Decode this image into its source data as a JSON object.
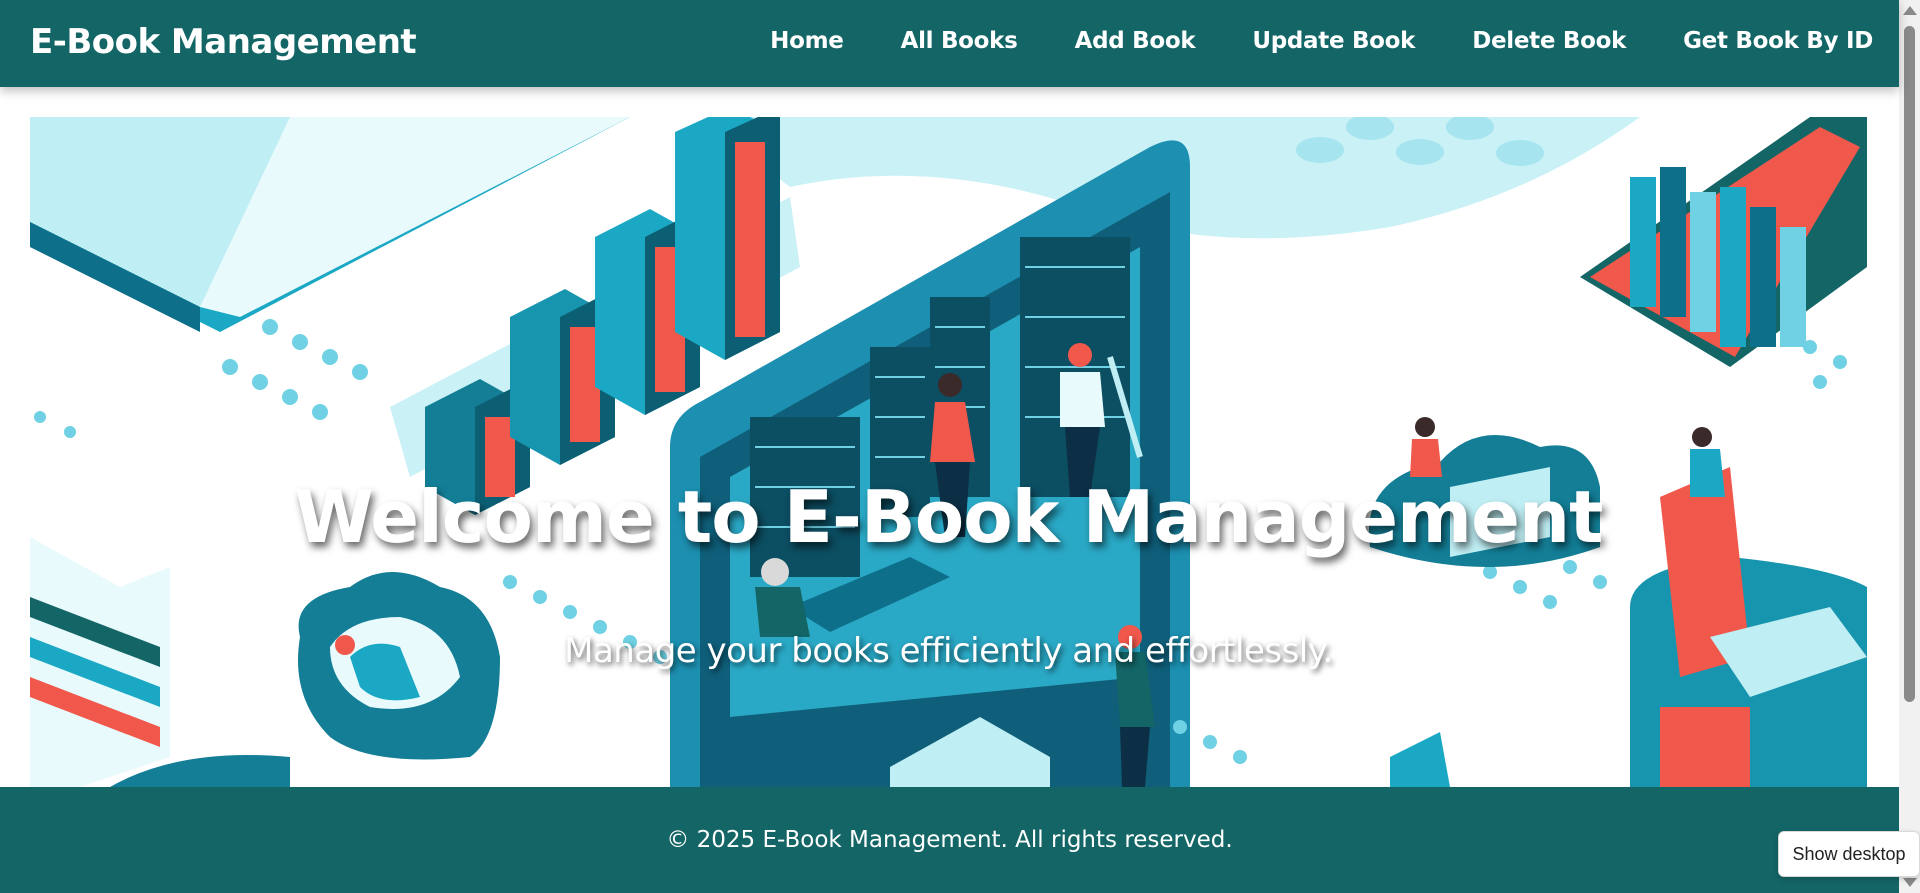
{
  "navbar": {
    "brand": "E-Book Management",
    "links": [
      {
        "label": "Home"
      },
      {
        "label": "All Books"
      },
      {
        "label": "Add Book"
      },
      {
        "label": "Update Book"
      },
      {
        "label": "Delete Book"
      },
      {
        "label": "Get Book By ID"
      }
    ]
  },
  "hero": {
    "title": "Welcome to E-Book Management",
    "subtitle": "Manage your books efficiently and effortlessly.",
    "illustration": "isometric-digital-library-illustration"
  },
  "footer": {
    "text": "© 2025 E-Book Management. All rights reserved."
  },
  "taskbar": {
    "show_desktop_tooltip": "Show desktop"
  },
  "colors": {
    "primary": "#136566",
    "accent_teal": "#1ba8c4",
    "light_teal": "#bfeef4",
    "coral": "#f0584b"
  }
}
